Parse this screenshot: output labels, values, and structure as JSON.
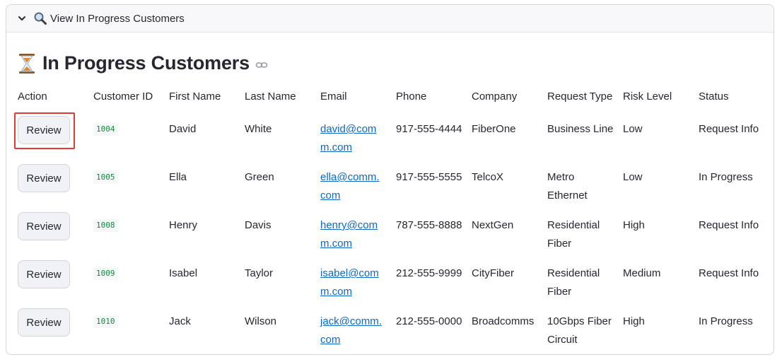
{
  "expander": {
    "label": "View In Progress Customers"
  },
  "page": {
    "title": "In Progress Customers"
  },
  "table": {
    "headers": [
      "Action",
      "Customer ID",
      "First Name",
      "Last Name",
      "Email",
      "Phone",
      "Company",
      "Request Type",
      "Risk Level",
      "Status"
    ],
    "rows": [
      {
        "action": "Review",
        "id": "1004",
        "first": "David",
        "last": "White",
        "email": "david@comm.com",
        "email_l1": "david@com",
        "email_l2": "m.com",
        "phone": "917-555-4444",
        "company": "FiberOne",
        "type": "Business Line",
        "risk": "Low",
        "status": "Request Info"
      },
      {
        "action": "Review",
        "id": "1005",
        "first": "Ella",
        "last": "Green",
        "email": "ella@comm.com",
        "email_l1": "ella@comm.",
        "email_l2": "com",
        "phone": "917-555-5555",
        "company": "TelcoX",
        "type": "Metro Ethernet",
        "risk": "Low",
        "status": "In Progress"
      },
      {
        "action": "Review",
        "id": "1008",
        "first": "Henry",
        "last": "Davis",
        "email": "henry@comm.com",
        "email_l1": "henry@com",
        "email_l2": "m.com",
        "phone": "787-555-8888",
        "company": "NextGen",
        "type": "Residential Fiber",
        "risk": "High",
        "status": "Request Info"
      },
      {
        "action": "Review",
        "id": "1009",
        "first": "Isabel",
        "last": "Taylor",
        "email": "isabel@comm.com",
        "email_l1": "isabel@com",
        "email_l2": "m.com",
        "phone": "212-555-9999",
        "company": "CityFiber",
        "type": "Residential Fiber",
        "risk": "Medium",
        "status": "Request Info"
      },
      {
        "action": "Review",
        "id": "1010",
        "first": "Jack",
        "last": "Wilson",
        "email": "jack@comm.com",
        "email_l1": "jack@comm.",
        "email_l2": "com",
        "phone": "212-555-0000",
        "company": "Broadcomms",
        "type": "10Gbps Fiber Circuit",
        "risk": "High",
        "status": "In Progress"
      }
    ]
  },
  "colors": {
    "highlight": "#e53935",
    "link": "#0b69c7",
    "code": "#0f8a3b"
  }
}
